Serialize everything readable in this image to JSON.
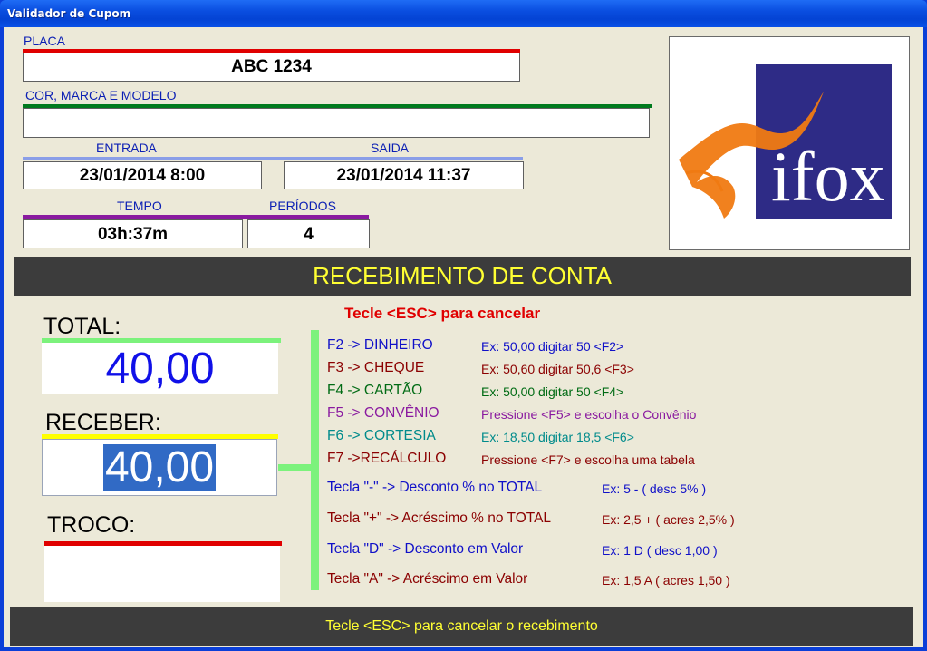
{
  "window": {
    "title": "Validador de Cupom"
  },
  "colors": {
    "blue": "#0b1fb4",
    "red": "#e00000",
    "green": "#007a1e",
    "maroon": "#8b0000",
    "purple": "#8a1aa0",
    "teal": "#008b8b",
    "yellow": "#ffff33"
  },
  "placa": {
    "label": "PLACA",
    "value": "ABC 1234"
  },
  "cor": {
    "label": "COR, MARCA E MODELO",
    "value": ""
  },
  "entrada": {
    "label": "ENTRADA",
    "value": "23/01/2014 8:00"
  },
  "saida": {
    "label": "SAIDA",
    "value": "23/01/2014 11:37"
  },
  "tempo": {
    "label": "TEMPO",
    "value": "03h:37m"
  },
  "periodos": {
    "label": "PERÍODOS",
    "value": "4"
  },
  "logo": {
    "text": "ifox"
  },
  "header": {
    "title": "RECEBIMENTO DE CONTA"
  },
  "total": {
    "label": "TOTAL:",
    "value": "40,00"
  },
  "receber": {
    "label": "RECEBER:",
    "value": "40,00"
  },
  "troco": {
    "label": "TROCO:",
    "value": ""
  },
  "cancel_hint": "Tecle <ESC> para cancelar",
  "shortcuts": [
    {
      "key": "F2 -> DINHEIRO",
      "example": "Ex: 50,00 digitar 50 <F2>"
    },
    {
      "key": "F3 -> CHEQUE",
      "example": "Ex: 50,60 digitar 50,6 <F3>"
    },
    {
      "key": "F4 -> CARTÃO",
      "example": "Ex: 50,00 digitar 50 <F4>"
    },
    {
      "key": "F5 -> CONVÊNIO",
      "example": "Pressione <F5> e escolha o Convênio"
    },
    {
      "key": "F6 -> CORTESIA",
      "example": "Ex: 18,50 digitar 18,5 <F6>"
    },
    {
      "key": "F7 ->RECÁLCULO",
      "example": "Pressione <F7> e escolha uma tabela"
    }
  ],
  "adjustments": [
    {
      "key": "Tecla \"-\" -> Desconto % no TOTAL",
      "example": "Ex: 5   - ( desc 5% )"
    },
    {
      "key": "Tecla \"+\" -> Acréscimo % no TOTAL",
      "example": "Ex: 2,5 + ( acres 2,5% )"
    },
    {
      "key": "Tecla \"D\" -> Desconto em Valor",
      "example": "Ex: 1   D ( desc 1,00 )"
    },
    {
      "key": "Tecla \"A\" -> Acréscimo em Valor",
      "example": "Ex: 1,5 A ( acres 1,50 )"
    }
  ],
  "footer": {
    "text": "Tecle <ESC> para cancelar o recebimento"
  }
}
